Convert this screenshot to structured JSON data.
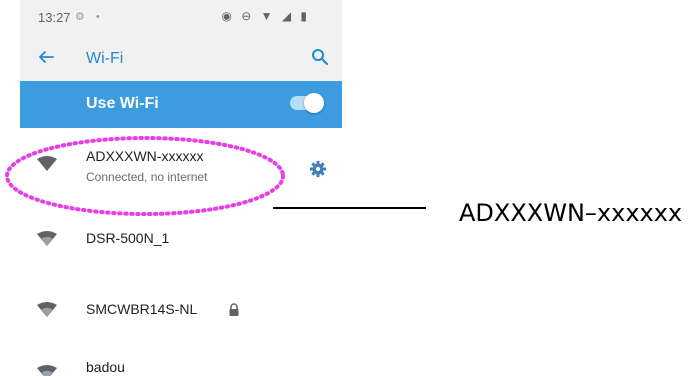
{
  "status_bar": {
    "time": "13:27",
    "left_icons": "⚙ •",
    "right_icons": "◉ ⊖ ▼ ◢ ▮"
  },
  "app_bar": {
    "back_icon": "arrow-left",
    "title": "Wi-Fi",
    "search_icon": "search"
  },
  "wifi_toggle": {
    "label": "Use Wi-Fi",
    "on": true
  },
  "networks": [
    {
      "name": "ADXXXWN-xxxxxx",
      "status": "Connected, no internet",
      "action_icon": "gear",
      "connected": true
    },
    {
      "name": "DSR-500N_1",
      "status": "",
      "secured": false
    },
    {
      "name": "SMCWBR14S-NL",
      "status": "",
      "secured": true
    },
    {
      "name": "badou",
      "status": "",
      "secured": false
    }
  ],
  "annotation": {
    "callout_text": "ADXXXWN–xxxxxx",
    "highlight_color": "#e83ee3"
  },
  "colors": {
    "accent": "#1f8ad6",
    "toggle_bar": "#3d9be0",
    "status_bar_bg": "#f1f1f1"
  }
}
